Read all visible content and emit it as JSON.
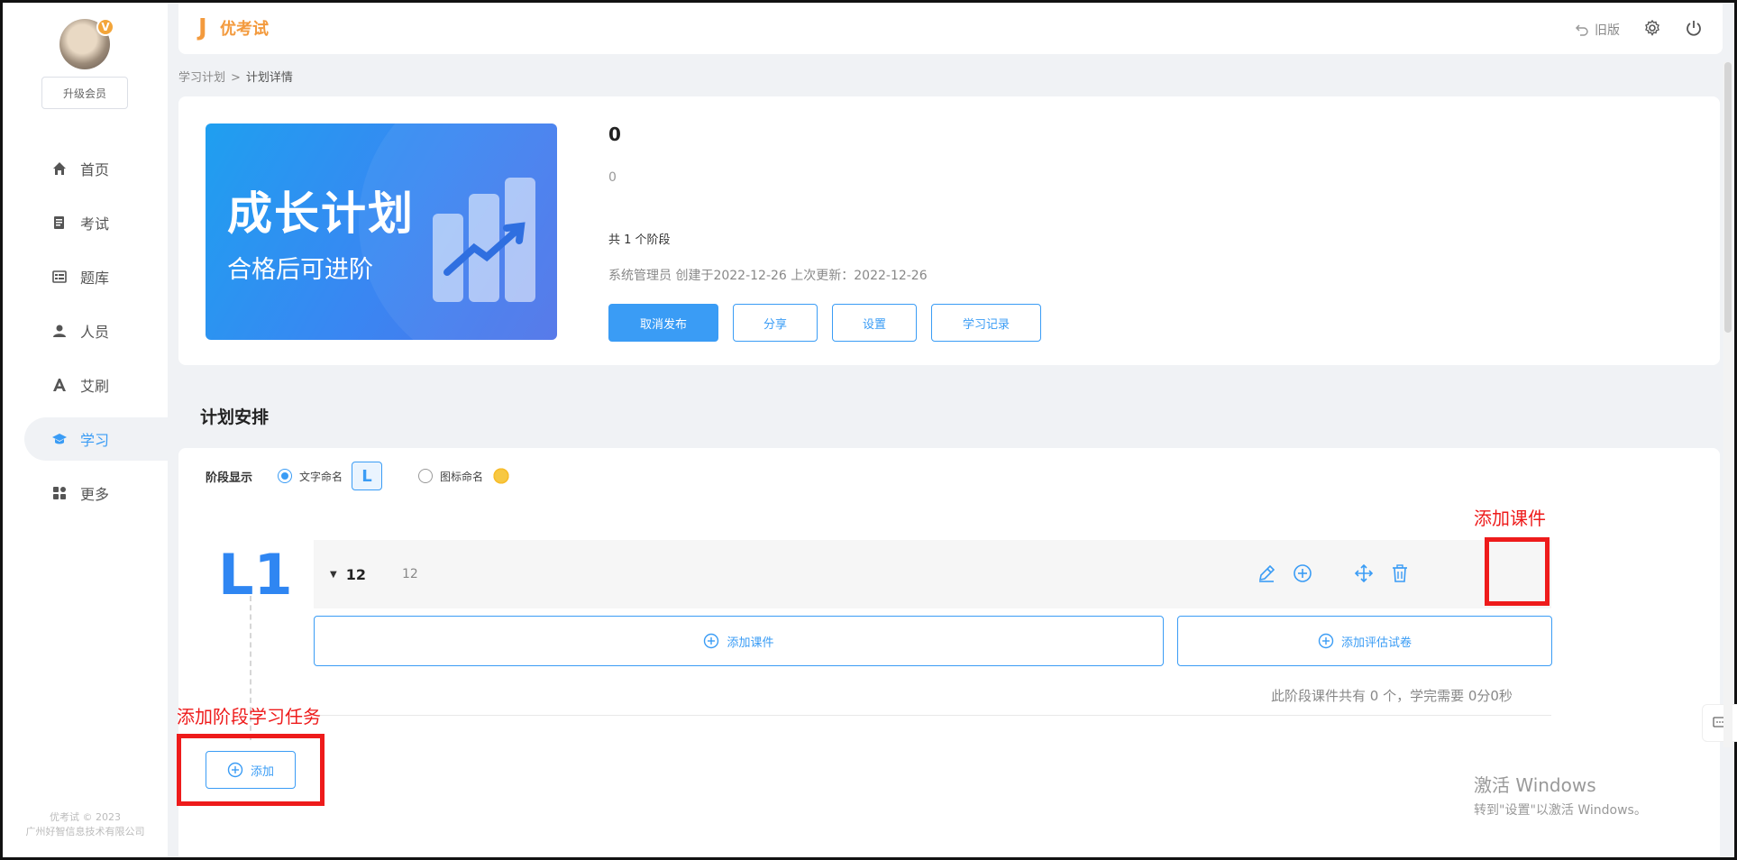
{
  "sidebar": {
    "vip_badge": "V",
    "upgrade_label": "升级会员",
    "items": [
      {
        "label": "首页",
        "icon": "home-icon"
      },
      {
        "label": "考试",
        "icon": "exam-icon"
      },
      {
        "label": "题库",
        "icon": "question-bank-icon"
      },
      {
        "label": "人员",
        "icon": "user-icon"
      },
      {
        "label": "艾刷",
        "icon": "font-a-icon"
      },
      {
        "label": "学习",
        "icon": "graduation-cap-icon"
      },
      {
        "label": "更多",
        "icon": "grid-icon"
      }
    ],
    "active_index": 5,
    "footer_line1": "优考试 © 2023",
    "footer_line2": "广州好智信息技术有限公司"
  },
  "header": {
    "logo_text": "优考试",
    "old_version_label": "旧版"
  },
  "breadcrumb": {
    "parent": "学习计划",
    "separator": ">",
    "current": "计划详情"
  },
  "plan": {
    "cover_title": "成长计划",
    "cover_subtitle": "合格后可进阶",
    "title": "0",
    "description": "0",
    "stages_text": "共 1 个阶段",
    "meta": "系统管理员 创建于2022-12-26 上次更新：2022-12-26",
    "actions": {
      "unpublish": "取消发布",
      "share": "分享",
      "settings": "设置",
      "records": "学习记录"
    }
  },
  "schedule": {
    "section_title": "计划安排",
    "stage_display_label": "阶段显示",
    "option_text": "文字命名",
    "option_icon": "图标命名",
    "l_badge": "L",
    "selected_option": "text",
    "level_label": "L1",
    "stage": {
      "caret": "▼",
      "name": "12",
      "desc": "12"
    },
    "add_course": "添加课件",
    "add_exam": "添加评估试卷",
    "summary": "此阶段课件共有 0 个，学完需要 0分0秒",
    "add_label": "添加"
  },
  "annotations": {
    "add_course": "添加课件",
    "add_stage_task": "添加阶段学习任务"
  },
  "watermark": {
    "line1": "激活 Windows",
    "line2": "转到\"设置\"以激活 Windows。"
  },
  "colors": {
    "primary": "#3a9cf5",
    "annotation": "#ee1b1b",
    "brand": "#f39a3d"
  }
}
